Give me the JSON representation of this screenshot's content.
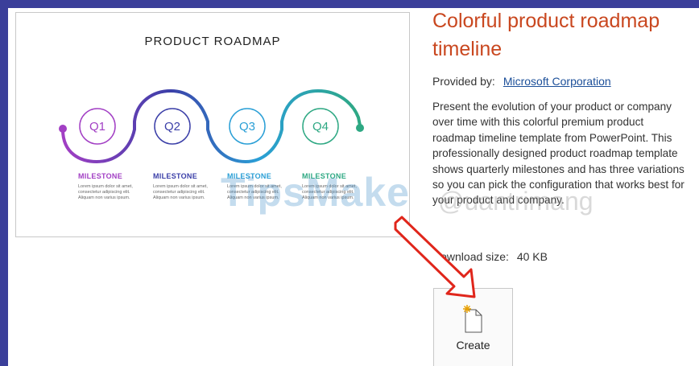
{
  "preview": {
    "title": "PRODUCT ROADMAP",
    "quarters": [
      "Q1",
      "Q2",
      "Q3",
      "Q4"
    ],
    "milestones": [
      {
        "title": "MILESTONE",
        "text": "Lorem ipsum dolor sit amet, consectetur adipiscing elit. Aliquam non varius ipsum.",
        "color": "#a23fc4"
      },
      {
        "title": "MILESTONE",
        "text": "Lorem ipsum dolor sit amet, consectetur adipiscing elit. Aliquam non varius ipsum.",
        "color": "#3b3fa8"
      },
      {
        "title": "MILESTONE",
        "text": "Lorem ipsum dolor sit amet, consectetur adipiscing elit. Aliquam non varius ipsum.",
        "color": "#2a9fd6"
      },
      {
        "title": "MILESTONE",
        "text": "Lorem ipsum dolor sit amet, consectetur adipiscing elit. Aliquam non varius ipsum.",
        "color": "#2ea883"
      }
    ]
  },
  "template": {
    "title": "Colorful product roadmap timeline",
    "provided_by_label": "Provided by:",
    "provider": "Microsoft Corporation",
    "description_lines": [
      "Present the evolution of your product or company",
      "over time with this colorful premium product",
      "roadmap timeline template from PowerPoint. This",
      "professionally designed product roadmap template",
      "shows quarterly milestones and has three variations",
      "so you can pick the configuration that works best for",
      "your product and company."
    ],
    "download_label": "Download size:",
    "download_size": "40 KB"
  },
  "create_button": {
    "label": "Create"
  },
  "watermarks": {
    "left": "TipsMake",
    "right": "@uantrimang"
  },
  "colors": {
    "title": "#c9471f",
    "link": "#1c4f99",
    "arrow": "#e0261b",
    "border": "#3b3f9a"
  }
}
